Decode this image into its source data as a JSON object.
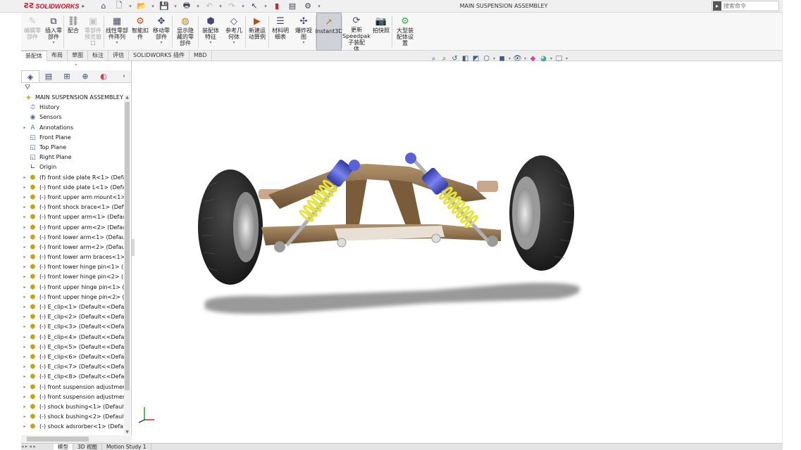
{
  "app": {
    "brand": "SOLIDWORKS",
    "document_title": "MAIN SUSPENSION ASSEMBLEY"
  },
  "search": {
    "placeholder": "搜索命令"
  },
  "quick_access": [
    "home-icon",
    "new-file-icon",
    "open-folder-icon",
    "save-icon",
    "print-icon",
    "undo-icon",
    "redo-icon",
    "select-icon",
    "rebuild-icon",
    "file-properties-icon",
    "options-icon"
  ],
  "ribbon": {
    "buttons": [
      {
        "label": "编辑零\n部件",
        "enabled": false
      },
      {
        "label": "插入零\n部件",
        "enabled": true
      },
      {
        "label": "配合",
        "enabled": true
      },
      {
        "label": "零部件\n预览窗\n口",
        "enabled": false
      },
      {
        "label": "线性零部\n件阵列",
        "enabled": true
      },
      {
        "label": "智能扣\n件",
        "enabled": true
      },
      {
        "label": "移动零\n部件",
        "enabled": true
      },
      {
        "label": "显示隐\n藏的零\n部件",
        "enabled": true
      },
      {
        "label": "装配体\n特征",
        "enabled": true
      },
      {
        "label": "参考几\n何体",
        "enabled": true
      },
      {
        "label": "新建运\n动算例",
        "enabled": true
      },
      {
        "label": "材料明\n细表",
        "enabled": true
      },
      {
        "label": "爆炸视\n图",
        "enabled": true
      },
      {
        "label": "Instant3D",
        "enabled": true,
        "active": true
      },
      {
        "label": "更新\nSpeedpak\n子装配\n体",
        "enabled": true
      },
      {
        "label": "拍快照",
        "enabled": true
      },
      {
        "label": "大型装\n配体设\n置",
        "enabled": true
      }
    ]
  },
  "tabs": [
    "装配体",
    "布局",
    "草图",
    "标注",
    "评估",
    "SOLIDWORKS 插件",
    "MBD"
  ],
  "active_tab": "装配体",
  "tree": {
    "root": "MAIN SUSPENSION ASSEMBLEY",
    "items": [
      {
        "label": "History",
        "icon": "history-icon",
        "kind": "folder",
        "expandable": false
      },
      {
        "label": "Sensors",
        "icon": "sensors-icon",
        "kind": "folder",
        "expandable": false
      },
      {
        "label": "Annotations",
        "icon": "annotations-icon",
        "kind": "folder",
        "expandable": true
      },
      {
        "label": "Front Plane",
        "icon": "plane-icon",
        "kind": "plane",
        "expandable": false
      },
      {
        "label": "Top Plane",
        "icon": "plane-icon",
        "kind": "plane",
        "expandable": false
      },
      {
        "label": "Right Plane",
        "icon": "plane-icon",
        "kind": "plane",
        "expandable": false
      },
      {
        "label": "Origin",
        "icon": "origin-icon",
        "kind": "origin",
        "expandable": false
      },
      {
        "label": "(f) front side plate R<1> (Defa",
        "icon": "part-icon",
        "kind": "part",
        "expandable": true
      },
      {
        "label": "(-) front side plate L<1> (Defa",
        "icon": "part-icon",
        "kind": "part",
        "expandable": true
      },
      {
        "label": "(-) front upper arm mount<1>",
        "icon": "part-icon",
        "kind": "part",
        "expandable": true
      },
      {
        "label": "(-) front shock brace<1> (Def",
        "icon": "part-icon",
        "kind": "part",
        "expandable": true
      },
      {
        "label": "(-) front upper arm<1> (Defau",
        "icon": "part-icon",
        "kind": "part",
        "expandable": true
      },
      {
        "label": "(-) front upper arm<2> (Defau",
        "icon": "part-icon",
        "kind": "part",
        "expandable": true
      },
      {
        "label": "(-) front lower arm<1> (Defau",
        "icon": "part-icon",
        "kind": "part",
        "expandable": true
      },
      {
        "label": "(-) front lower arm<2> (Defau",
        "icon": "part-icon",
        "kind": "part",
        "expandable": true
      },
      {
        "label": "(-) front lower arm braces<1>",
        "icon": "part-icon",
        "kind": "part",
        "expandable": true
      },
      {
        "label": "(-) front lower hinge pin<1> (I",
        "icon": "part-icon",
        "kind": "part",
        "expandable": true
      },
      {
        "label": "(-) front lower hinge pin<2> (I",
        "icon": "part-icon",
        "kind": "part",
        "expandable": true
      },
      {
        "label": "(-) front upper hinge pin<1> (",
        "icon": "part-icon",
        "kind": "part",
        "expandable": true
      },
      {
        "label": "(-) front upper hinge pin<2> (",
        "icon": "part-icon",
        "kind": "part",
        "expandable": true
      },
      {
        "label": "(-) E_clip<1> (Default<<Defau",
        "icon": "part-icon",
        "kind": "part",
        "expandable": true
      },
      {
        "label": "(-) E_clip<2> (Default<<Defau",
        "icon": "part-icon",
        "kind": "part",
        "expandable": true
      },
      {
        "label": "(-) E_clip<3> (Default<<Defau",
        "icon": "part-icon",
        "kind": "part",
        "expandable": true
      },
      {
        "label": "(-) E_clip<4> (Default<<Defau",
        "icon": "part-icon",
        "kind": "part",
        "expandable": true
      },
      {
        "label": "(-) E_clip<5> (Default<<Defau",
        "icon": "part-icon",
        "kind": "part",
        "expandable": true
      },
      {
        "label": "(-) E_clip<6> (Default<<Defau",
        "icon": "part-icon",
        "kind": "part",
        "expandable": true
      },
      {
        "label": "(-) E_clip<7> (Default<<Defau",
        "icon": "part-icon",
        "kind": "part",
        "expandable": true
      },
      {
        "label": "(-) E_clip<8> (Default<<Defau",
        "icon": "part-icon",
        "kind": "part",
        "expandable": true
      },
      {
        "label": "(-) front suspension adjustmer",
        "icon": "part-icon",
        "kind": "part",
        "expandable": true
      },
      {
        "label": "(-) front suspension adjustmer",
        "icon": "part-icon",
        "kind": "part",
        "expandable": true
      },
      {
        "label": "(-) shock bushing<1> (Default",
        "icon": "part-icon",
        "kind": "part",
        "expandable": true
      },
      {
        "label": "(-) shock bushing<2> (Default",
        "icon": "part-icon",
        "kind": "part",
        "expandable": true
      },
      {
        "label": "(-) shock adsrorber<1> (Defa",
        "icon": "part-icon",
        "kind": "part",
        "expandable": true
      }
    ]
  },
  "bottom_tabs": [
    "模型",
    "3D 视图",
    "Motion Study 1"
  ],
  "active_bottom_tab": "模型",
  "colors": {
    "brand_red": "#d0102b",
    "tire": "#2a2a2a",
    "arm_bronze": "#8a6a44",
    "shock_blue": "#4b55c8",
    "spring_yellow": "#e6e23a",
    "background": "#ffffff"
  }
}
